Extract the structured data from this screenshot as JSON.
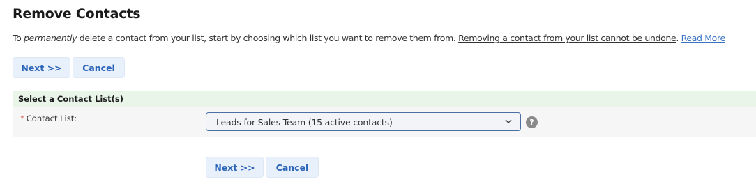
{
  "page": {
    "title": "Remove Contacts",
    "intro": {
      "prefix": "To ",
      "emphasis": "permanently",
      "middle": " delete a contact from your list, start by choosing which list you want to remove them from. ",
      "warning": "Removing a contact from your list cannot be undone",
      "period": ". ",
      "link": "Read More"
    }
  },
  "top_actions": {
    "next_label": "Next >>",
    "cancel_label": "Cancel"
  },
  "section": {
    "header": "Select a Contact List(s)",
    "field": {
      "required_marker": "*",
      "label": "Contact List:",
      "selected_value": "Leads for Sales Team (15 active contacts)",
      "help_symbol": "?"
    }
  },
  "bottom_actions": {
    "next_label": "Next >>",
    "cancel_label": "Cancel"
  },
  "colors": {
    "button_bg": "#e8f0fb",
    "button_text": "#2c64b8",
    "section_header_bg": "#eaf5ea",
    "section_body_bg": "#f6f6f6",
    "link": "#3b72c4",
    "required": "#d9534f"
  }
}
